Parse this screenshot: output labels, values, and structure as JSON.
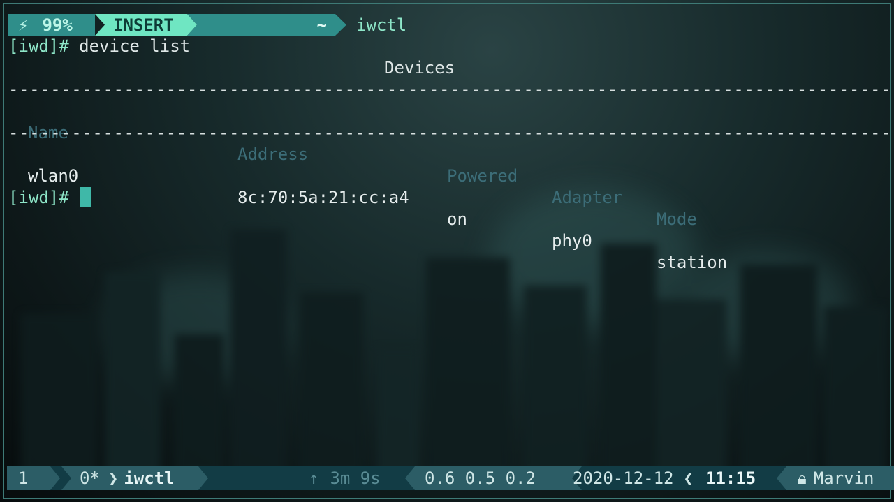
{
  "top_status": {
    "battery_icon": "lightning-icon",
    "battery_percent": "99%",
    "mode": "INSERT",
    "directory": "~",
    "command": "iwctl"
  },
  "terminal": {
    "prompt": "[iwd]#",
    "command": " device list",
    "title": "Devices",
    "separator": "------------------------------------------------------------------------------------------------------------",
    "headers": {
      "name": "Name",
      "address": "Address",
      "powered": "Powered",
      "adapter": "Adapter",
      "mode": "Mode"
    },
    "rows": [
      {
        "name": "wlan0",
        "address": "8c:70:5a:21:cc:a4",
        "powered": "on",
        "adapter": "phy0",
        "mode": "station"
      }
    ],
    "prompt2": "[iwd]#"
  },
  "bottom_status": {
    "window1": "1",
    "window2_index": "0*",
    "window2_sep": "❯",
    "window2_name": "iwctl",
    "uptime_icon": "up-arrow-icon",
    "uptime": "3m 9s",
    "load": "0.6 0.5 0.2",
    "date": "2020-12-12",
    "date_sep": "❮",
    "time": "11:15",
    "user_icon": "lock-icon",
    "user": "Marvin"
  }
}
